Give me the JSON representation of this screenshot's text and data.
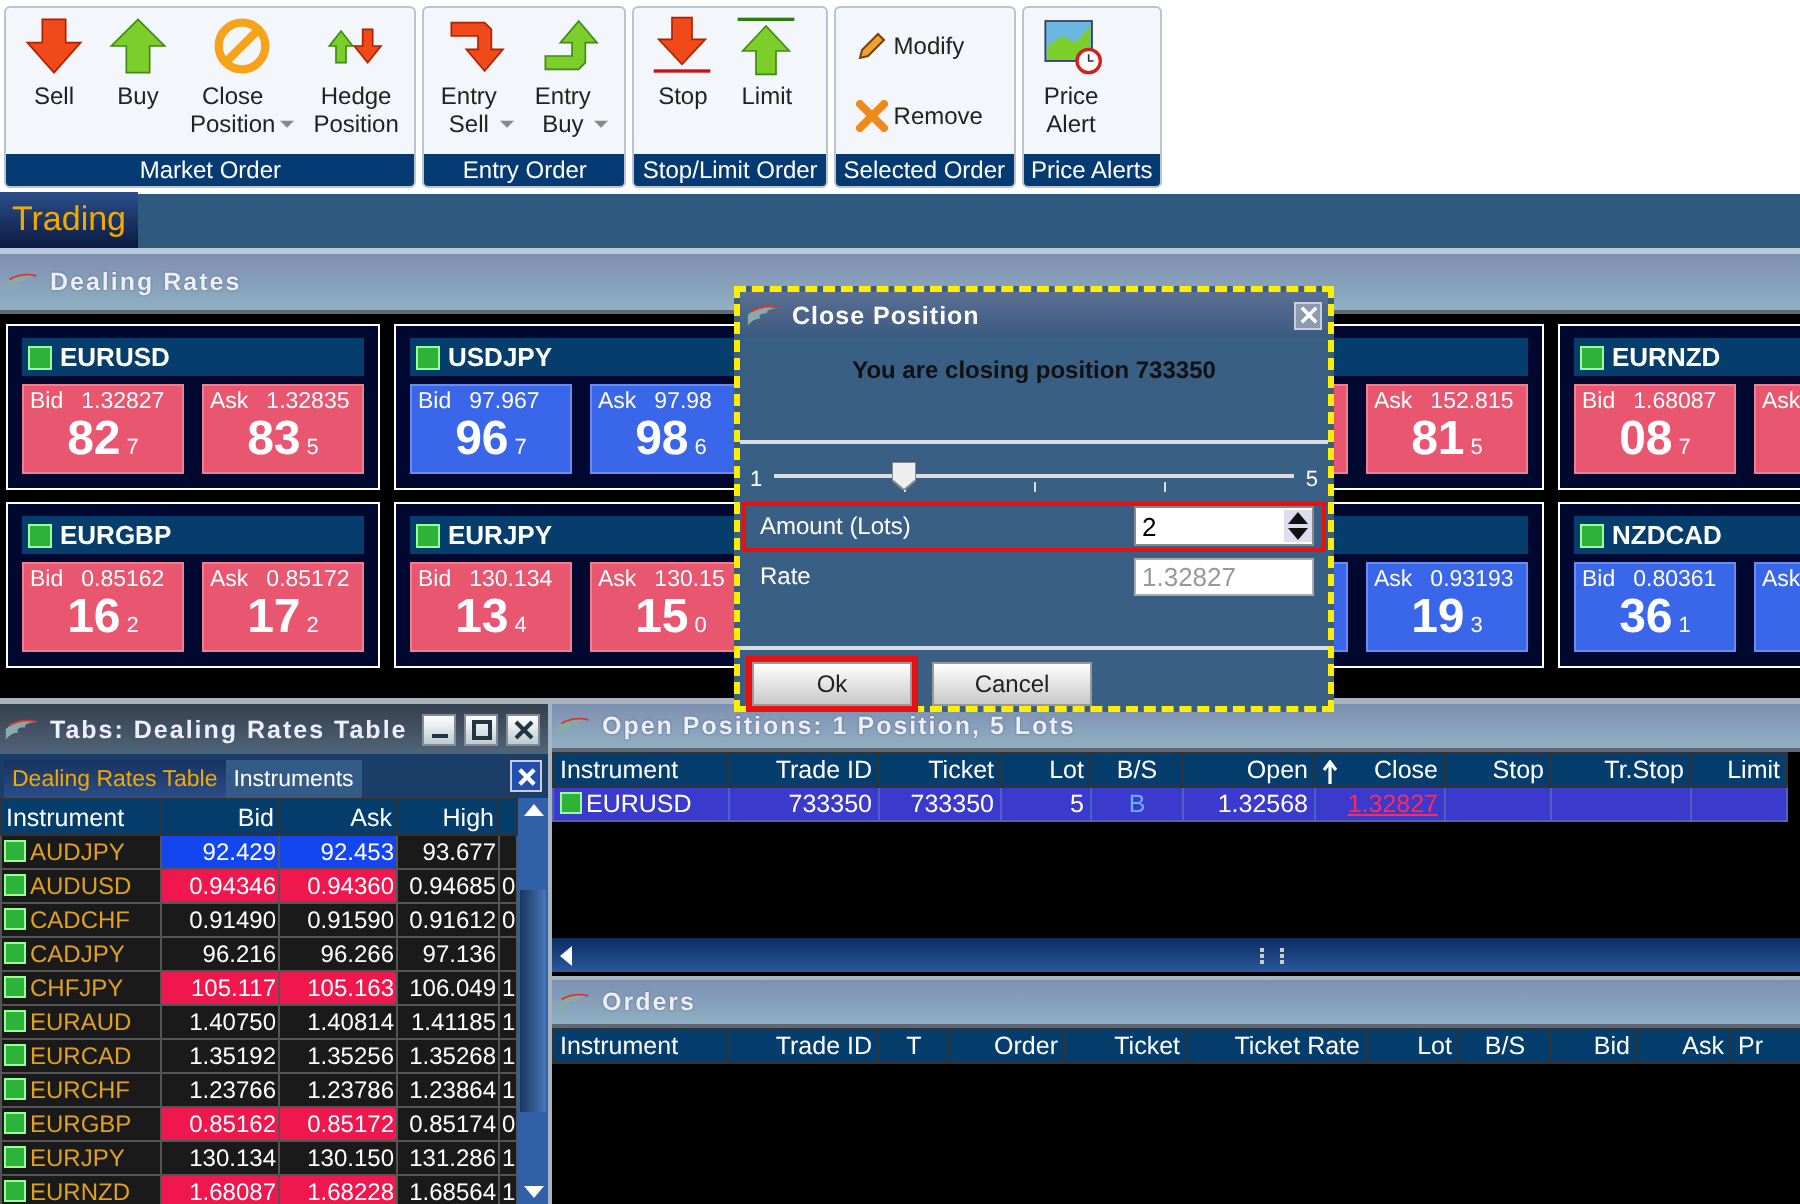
{
  "toolbar": {
    "groups": [
      {
        "label": "Market Order",
        "buttons": [
          {
            "kind": "sell",
            "label": "Sell",
            "dropdown": false
          },
          {
            "kind": "buy",
            "label": "Buy",
            "dropdown": false
          },
          {
            "kind": "close",
            "label": "Close Position",
            "dropdown": true
          },
          {
            "kind": "hedge",
            "label": "Hedge Position",
            "dropdown": false
          }
        ]
      },
      {
        "label": "Entry Order",
        "buttons": [
          {
            "kind": "entry-sell",
            "label": "Entry Sell",
            "dropdown": true
          },
          {
            "kind": "entry-buy",
            "label": "Entry Buy",
            "dropdown": true
          }
        ]
      },
      {
        "label": "Stop/Limit Order",
        "buttons": [
          {
            "kind": "stop",
            "label": "Stop",
            "dropdown": false
          },
          {
            "kind": "limit",
            "label": "Limit",
            "dropdown": false
          }
        ]
      },
      {
        "label": "Selected Order",
        "buttons": [
          {
            "kind": "modify",
            "label": "Modify",
            "dropdown": false
          },
          {
            "kind": "remove",
            "label": "Remove",
            "dropdown": false
          }
        ]
      },
      {
        "label": "Price Alerts",
        "buttons": [
          {
            "kind": "alert",
            "label": "Price Alert",
            "dropdown": false
          }
        ]
      }
    ]
  },
  "workspace_tabs": [
    {
      "label": "Trading",
      "selected": true
    }
  ],
  "dealing_rates": {
    "title": "Dealing Rates",
    "rows": [
      [
        {
          "name": "EURUSD",
          "bid": {
            "label": "Bid",
            "price": "1.32827",
            "big": "82",
            "pip": "7",
            "color": "#e8566f"
          },
          "ask": {
            "label": "Ask",
            "price": "1.32835",
            "big": "83",
            "pip": "5",
            "color": "#e8566f"
          }
        },
        {
          "name": "USDJPY",
          "bid": {
            "label": "Bid",
            "price": "97.967",
            "big": "96",
            "pip": "7",
            "color": "#3a66ea"
          },
          "ask": {
            "label": "Ask",
            "price": "97.98",
            "big": "98",
            "pip": "6",
            "color": "#3a66ea"
          }
        },
        null,
        {
          "bid": {
            "color": "#e8566f"
          },
          "ask": {
            "label": "Ask",
            "price": "152.815",
            "big": "81",
            "pip": "5",
            "color": "#e8566f"
          }
        },
        {
          "name": "EURNZD",
          "bid": {
            "label": "Bid",
            "price": "1.68087",
            "big": "08",
            "pip": "7",
            "color": "#e8566f"
          },
          "ask": {
            "label": "Ask",
            "color": "#e8566f"
          }
        }
      ],
      [
        {
          "name": "EURGBP",
          "bid": {
            "label": "Bid",
            "price": "0.85162",
            "big": "16",
            "pip": "2",
            "color": "#e8566f"
          },
          "ask": {
            "label": "Ask",
            "price": "0.85172",
            "big": "17",
            "pip": "2",
            "color": "#e8566f"
          }
        },
        {
          "name": "EURJPY",
          "bid": {
            "label": "Bid",
            "price": "130.134",
            "big": "13",
            "pip": "4",
            "color": "#e8566f"
          },
          "ask": {
            "label": "Ask",
            "price": "130.15",
            "big": "15",
            "pip": "0",
            "color": "#e8566f"
          }
        },
        null,
        {
          "bid": {
            "color": "#3a66ea"
          },
          "ask": {
            "label": "Ask",
            "price": "0.93193",
            "big": "19",
            "pip": "3",
            "color": "#3a66ea"
          }
        },
        {
          "name": "NZDCAD",
          "bid": {
            "label": "Bid",
            "price": "0.80361",
            "big": "36",
            "pip": "1",
            "color": "#3a66ea"
          },
          "ask": {
            "label": "Ask",
            "color": "#3a66ea"
          }
        }
      ]
    ]
  },
  "rates_table_panel": {
    "title": "Tabs: Dealing Rates Table",
    "tabs": [
      {
        "label": "Dealing Rates Table",
        "selected": true
      },
      {
        "label": "Instruments",
        "selected": false
      }
    ],
    "columns": [
      "Instrument",
      "Bid",
      "Ask",
      "High"
    ],
    "rows": [
      {
        "instrument": "AUDJPY",
        "bid": "92.429",
        "ask": "92.453",
        "high": "93.677",
        "color": "#1446f0"
      },
      {
        "instrument": "AUDUSD",
        "bid": "0.94346",
        "ask": "0.94360",
        "high": "0.94685",
        "column_5": "0",
        "color": "#f0164e"
      },
      {
        "instrument": "CADCHF",
        "bid": "0.91490",
        "ask": "0.91590",
        "high": "0.91612",
        "column_5": "0"
      },
      {
        "instrument": "CADJPY",
        "bid": "96.216",
        "ask": "96.266",
        "high": "97.136"
      },
      {
        "instrument": "CHFJPY",
        "bid": "105.117",
        "ask": "105.163",
        "high": "106.049",
        "column_5": "1",
        "color": "#f0164e"
      },
      {
        "instrument": "EURAUD",
        "bid": "1.40750",
        "ask": "1.40814",
        "high": "1.41185",
        "column_5": "1"
      },
      {
        "instrument": "EURCAD",
        "bid": "1.35192",
        "ask": "1.35256",
        "high": "1.35268",
        "column_5": "1"
      },
      {
        "instrument": "EURCHF",
        "bid": "1.23766",
        "ask": "1.23786",
        "high": "1.23864",
        "column_5": "1"
      },
      {
        "instrument": "EURGBP",
        "bid": "0.85162",
        "ask": "0.85172",
        "high": "0.85174",
        "column_5": "0",
        "color": "#f0164e"
      },
      {
        "instrument": "EURJPY",
        "bid": "130.134",
        "ask": "130.150",
        "high": "131.286",
        "column_5": "1"
      },
      {
        "instrument": "EURNZD",
        "bid": "1.68087",
        "ask": "1.68228",
        "high": "1.68564",
        "column_5": "1",
        "color": "#f0164e"
      }
    ]
  },
  "open_positions": {
    "title": "Open Positions: 1 Position, 5 Lots",
    "columns": [
      "Instrument",
      "Trade ID",
      "Ticket",
      "Lot",
      "B/S",
      "Open",
      "Close",
      "Stop",
      "Tr.Stop",
      "Limit"
    ],
    "rows": [
      {
        "selected": true,
        "cells": [
          "EURUSD",
          "733350",
          "733350",
          "5",
          "B",
          "1.32568",
          "1.32827",
          "",
          "",
          ""
        ]
      }
    ]
  },
  "orders": {
    "title": "Orders",
    "columns": [
      "Instrument",
      "Trade ID",
      "T",
      "Order",
      "Ticket",
      "Ticket Rate",
      "Lot",
      "B/S",
      "Bid",
      "Ask",
      "Pr"
    ]
  },
  "close_dialog": {
    "title": "Close Position",
    "message": "You are closing position 733350",
    "slider": {
      "min": "1",
      "max": "5",
      "level": 0.25
    },
    "amount_label": "Amount (Lots)",
    "amount_value": "2",
    "rate_label": "Rate",
    "rate_value": "1.32827",
    "buttons": [
      {
        "label": "Ok",
        "focused": true
      },
      {
        "label": "Cancel",
        "focused": false
      }
    ]
  }
}
